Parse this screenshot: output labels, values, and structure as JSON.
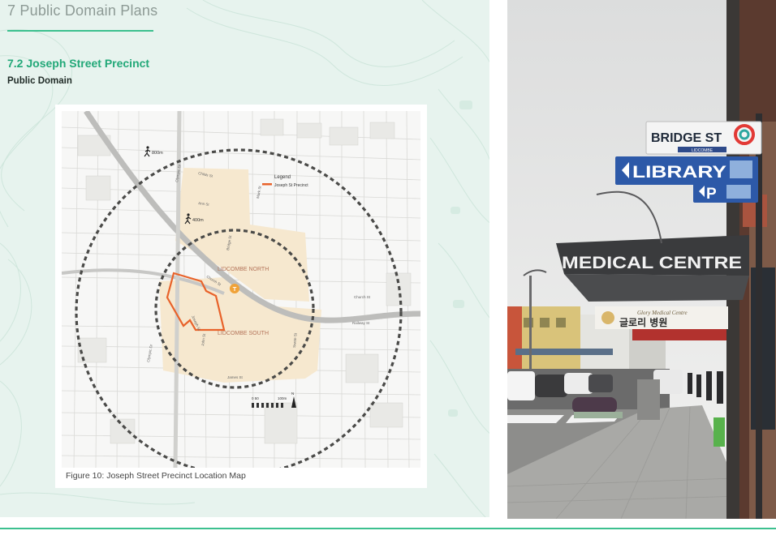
{
  "chapter": {
    "title": "7 Public Domain Plans"
  },
  "section": {
    "title": "7.2 Joseph Street Precinct",
    "subtitle": "Public Domain"
  },
  "map": {
    "legend_title": "Legend",
    "legend_item": "Joseph St Precinct",
    "walk_outer": "800m",
    "walk_inner": "400m",
    "area_north": "LIDCOMBE NORTH",
    "area_south": "LIDCOMBE SOUTH",
    "station_glyph": "T",
    "streets": {
      "olympic_top": "Olympic Dr",
      "olympic_bottom": "Olympic Dr",
      "childs": "Childs St",
      "ann": "Ann St",
      "bridge": "Bridge St",
      "mark": "Mark St",
      "church_1": "Church St",
      "church_2": "Church St",
      "railway": "Railway St",
      "joseph": "Joseph St",
      "john": "John St",
      "james": "James St",
      "swete": "Swete St"
    },
    "scale_start": "0  50",
    "scale_end": "100m",
    "north": "N",
    "precinct_color": "#e8622a",
    "area_color": "#b4745a"
  },
  "figure": {
    "caption": "Figure 10: Joseph Street Precinct Location Map"
  },
  "photo": {
    "sign_bridge": "BRIDGE ST",
    "sign_bridge_suburb": "LIDCOMBE",
    "sign_library": "LIBRARY",
    "sign_parking": "P",
    "sign_medical": "MEDICAL CENTRE",
    "sign_glory_en": "Glory Medical Centre",
    "sign_glory_kr": "글로리 병원"
  }
}
